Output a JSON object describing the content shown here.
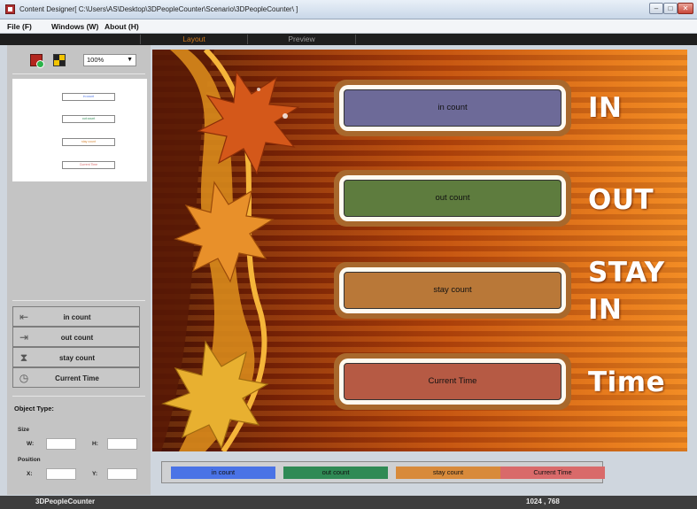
{
  "window": {
    "title": "Content Designer[ C:\\Users\\AS\\Desktop\\3DPeopleCounter\\Scenario\\3DPeopleCounter\\ ]",
    "minimize": "–",
    "maximize": "□",
    "close": "✕"
  },
  "menu": [
    "File (F)",
    "Windows (W)",
    "About (H)"
  ],
  "tabs": {
    "layout": "Layout",
    "preview": "Preview"
  },
  "toolbar": {
    "zoom": "100%"
  },
  "thumbnail": [
    "in count",
    "out count",
    "stay count",
    "Current Time"
  ],
  "objects": [
    {
      "label": "in count",
      "icon": "enter-icon",
      "glyph": "⇤"
    },
    {
      "label": "out count",
      "icon": "exit-icon",
      "glyph": "⇥"
    },
    {
      "label": "stay count",
      "icon": "hourglass-icon",
      "glyph": "⧗"
    },
    {
      "label": "Current Time",
      "icon": "clock-icon",
      "glyph": "◷"
    }
  ],
  "properties": {
    "title": "Object Type:",
    "size_label": "Size",
    "w_label": "W:",
    "h_label": "H:",
    "position_label": "Position",
    "x_label": "X:",
    "y_label": "Y:"
  },
  "canvas": {
    "counters": [
      {
        "text": "in count",
        "color": "#6d6a98"
      },
      {
        "text": "out count",
        "color": "#5e7c3e"
      },
      {
        "text": "stay count",
        "color": "#b97838"
      },
      {
        "text": "Current Time",
        "color": "#b65a44"
      }
    ],
    "labels": [
      "IN",
      "OUT",
      "STAY",
      "IN",
      "Time"
    ]
  },
  "colorbar": [
    {
      "text": "in count",
      "color": "#4a73e6"
    },
    {
      "text": "out count",
      "color": "#2f8a55"
    },
    {
      "text": "stay count",
      "color": "#d88a3a"
    },
    {
      "text": "Current Time",
      "color": "#d96a6a"
    }
  ],
  "status": {
    "app": "3DPeopleCounter",
    "resolution": "1024 , 768"
  }
}
